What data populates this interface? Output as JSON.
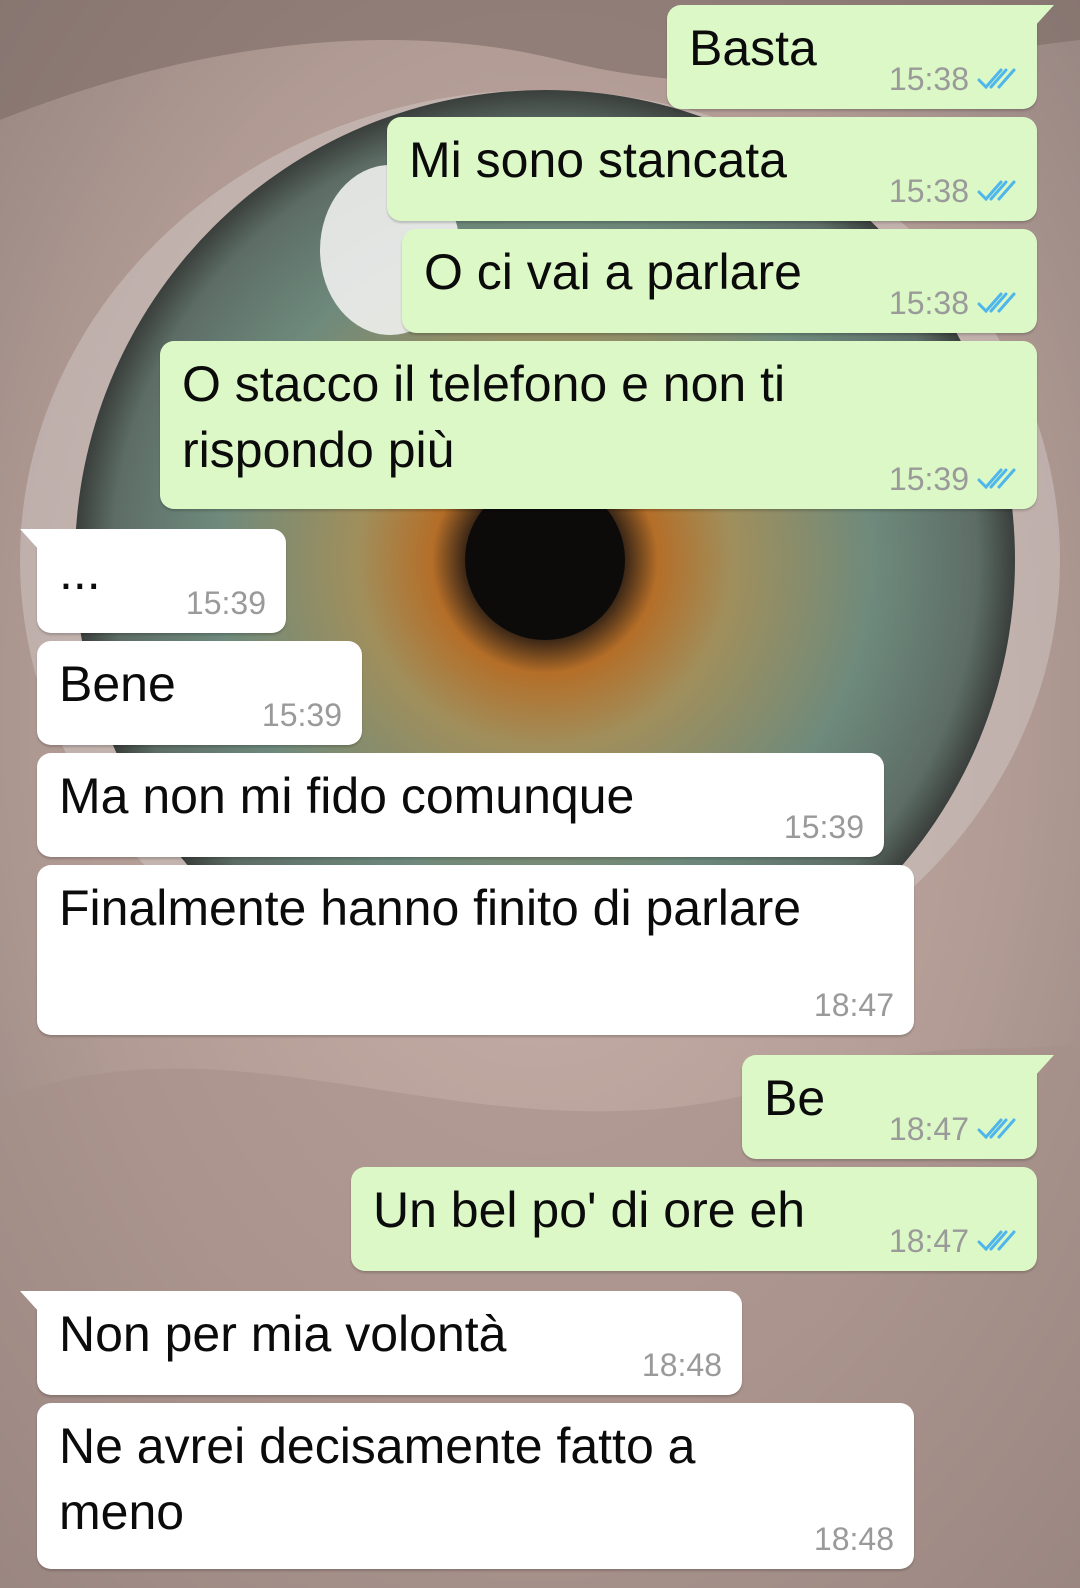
{
  "colors": {
    "outgoing_bubble": "#dcf8c6",
    "incoming_bubble": "#ffffff",
    "read_ticks": "#4fb6ec",
    "timestamp": "#9a9a9a"
  },
  "wallpaper": {
    "subject": "close-up eye photo"
  },
  "messages": [
    {
      "dir": "out",
      "text": "Basta",
      "time": "15:38",
      "status": "read-double-check-icon"
    },
    {
      "dir": "out",
      "text": "Mi sono stancata",
      "time": "15:38",
      "status": "read-double-check-icon"
    },
    {
      "dir": "out",
      "text": "O ci vai a parlare",
      "time": "15:38",
      "status": "read-double-check-icon"
    },
    {
      "dir": "out",
      "text": "O stacco il telefono e non ti\nrispondo più",
      "time": "15:39",
      "status": "read-double-check-icon"
    },
    {
      "dir": "in",
      "text": "...",
      "time": "15:39"
    },
    {
      "dir": "in",
      "text": "Bene",
      "time": "15:39"
    },
    {
      "dir": "in",
      "text": "Ma non mi fido comunque",
      "time": "15:39"
    },
    {
      "dir": "in",
      "text": "Finalmente hanno finito di parlare",
      "time": "18:47"
    },
    {
      "dir": "out",
      "text": "Be",
      "time": "18:47",
      "status": "read-double-check-icon"
    },
    {
      "dir": "out",
      "text": "Un bel po' di ore eh",
      "time": "18:47",
      "status": "read-double-check-icon"
    },
    {
      "dir": "in",
      "text": "Non per mia volontà",
      "time": "18:48"
    },
    {
      "dir": "in",
      "text": "Ne avrei decisamente fatto a\nmeno",
      "time": "18:48"
    }
  ]
}
